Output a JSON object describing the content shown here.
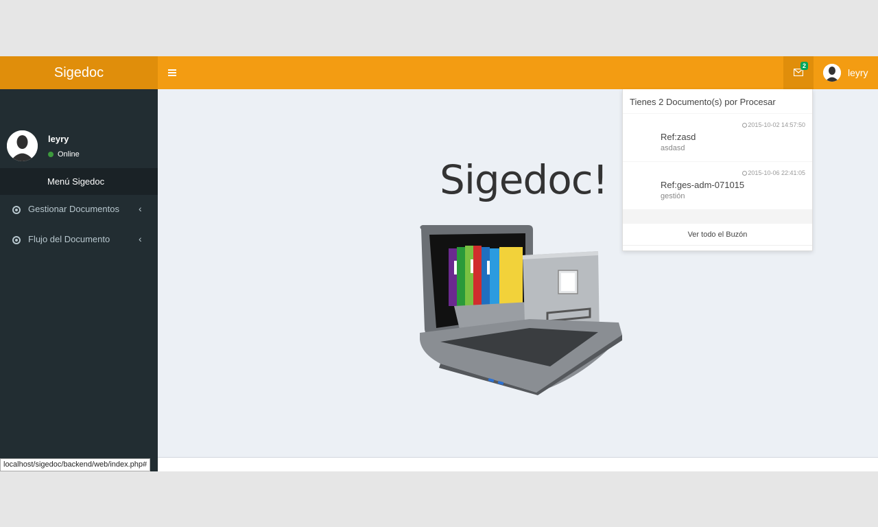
{
  "header": {
    "logo": "Sigedoc",
    "mail_badge_count": "2",
    "user_name": "leyry"
  },
  "sidebar": {
    "user_name": "leyry",
    "status": "Online",
    "menu_header": "Menú Sigedoc",
    "items": [
      {
        "label": "Gestionar Documentos"
      },
      {
        "label": "Flujo del Documento"
      }
    ]
  },
  "main": {
    "title": "Sigedoc!"
  },
  "notifications": {
    "header": "Tienes 2 Documento(s) por Procesar",
    "items": [
      {
        "time": "2015-10-02 14:57:50",
        "ref": "Ref:zasd",
        "desc": "asdasd"
      },
      {
        "time": "2015-10-06 22:41:05",
        "ref": "Ref:ges-adm-071015",
        "desc": "gestión"
      }
    ],
    "footer": "Ver todo el Buzón"
  },
  "status_bar": {
    "url": "localhost/sigedoc/backend/web/index.php#"
  },
  "colors": {
    "navbar": "#f39c12",
    "logo_bg": "#e08e0b",
    "sidebar": "#222d32",
    "badge": "#00a65a"
  }
}
